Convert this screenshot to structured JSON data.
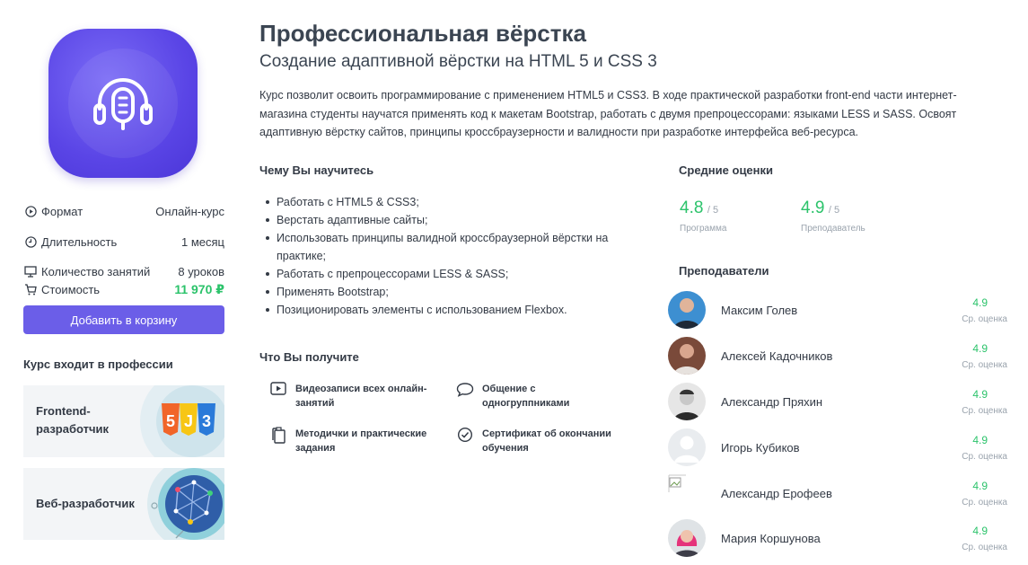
{
  "course": {
    "title": "Профессиональная вёрстка",
    "subtitle": "Создание адаптивной вёрстки на HTML 5 и CSS 3",
    "description": "Курс позволит освоить программирование с применением HTML5 и CSS3. В ходе практической разработки front-end части интернет-магазина студенты научатся применять код к макетам Bootstrap, работать с двумя препроцессорами: языками LESS и SASS. Освоят адаптивную вёрстку сайтов, принципы кроссбраузерности и валидности при разработке интерфейса веб-ресурса.",
    "logo_icon": "headphones-microphone-icon"
  },
  "info": {
    "format_label": "Формат",
    "format_value": "Онлайн-курс",
    "duration_label": "Длительность",
    "duration_value": "1 месяц",
    "lessons_label": "Количество занятий",
    "lessons_value": "8 уроков",
    "price_label": "Стоимость",
    "price_value": "11 970 ₽"
  },
  "cart_button": "Добавить в корзину",
  "professions": {
    "heading": "Курс входит в профессии",
    "items": [
      {
        "line1": "Frontend-",
        "line2": "разработчик",
        "icon": "html5-js-css3-icon"
      },
      {
        "line1": "Веб-разработчик",
        "line2": "",
        "icon": "globe-network-icon"
      }
    ]
  },
  "learn": {
    "heading": "Чему Вы научитесь",
    "items": [
      "Работать с HTML5 & CSS3;",
      "Верстать адаптивные сайты;",
      "Использовать принципы валидной кроссбраузерной вёрстки на практике;",
      "Работать с препроцессорами LESS & SASS;",
      "Применять Bootstrap;",
      "Позиционировать элементы с использованием Flexbox."
    ]
  },
  "get": {
    "heading": "Что Вы получите",
    "items": [
      {
        "line1": "Видеозаписи всех онлайн-",
        "line2": "занятий",
        "icon": "video-play-icon"
      },
      {
        "line1": "Общение с",
        "line2": "одногруппниками",
        "icon": "chat-bubble-icon"
      },
      {
        "line1": "Методички и практические",
        "line2": "задания",
        "icon": "documents-icon"
      },
      {
        "line1": "Сертификат об окончании",
        "line2": "обучения",
        "icon": "checkmark-circle-icon"
      }
    ]
  },
  "ratings": {
    "heading": "Средние оценки",
    "program_value": "4.8",
    "program_max": "/ 5",
    "program_caption": "Программа",
    "teacher_value": "4.9",
    "teacher_max": "/ 5",
    "teacher_caption": "Преподаватель"
  },
  "teachers": {
    "heading": "Преподаватели",
    "rating_caption": "Ср. оценка",
    "items": [
      {
        "name": "Максим Голев",
        "rating": "4.9"
      },
      {
        "name": "Алексей Кадочников",
        "rating": "4.9"
      },
      {
        "name": "Александр Пряхин",
        "rating": "4.9"
      },
      {
        "name": "Игорь Кубиков",
        "rating": "4.9"
      },
      {
        "name": "Александр Ерофеев",
        "rating": "4.9"
      },
      {
        "name": "Мария Коршунова",
        "rating": "4.9"
      }
    ]
  },
  "colors": {
    "accent": "#6b5ee8",
    "green": "#2cc36b",
    "text": "#333a45",
    "muted": "#9aa3ad"
  }
}
